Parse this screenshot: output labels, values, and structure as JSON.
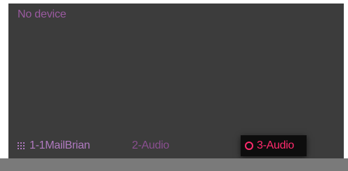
{
  "device_panel": {
    "status": "No device"
  },
  "tracks": [
    {
      "label": "1-1MailBrian",
      "icon": "grid-icon",
      "state": "inactive"
    },
    {
      "label": "2-Audio",
      "icon": "",
      "state": "inactive"
    },
    {
      "label": "3-Audio",
      "icon": "record-circle-icon",
      "state": "selected"
    }
  ],
  "colors": {
    "panel_background": "#3c3c3c",
    "status_text": "#9a5aa0",
    "track_label": "#b07ac0",
    "track_label_dim": "#8a4f90",
    "selected_track_text": "#ff2a6d",
    "selected_track_background": "#0d0d0d",
    "bottom_bar": "#7a7a7a"
  }
}
